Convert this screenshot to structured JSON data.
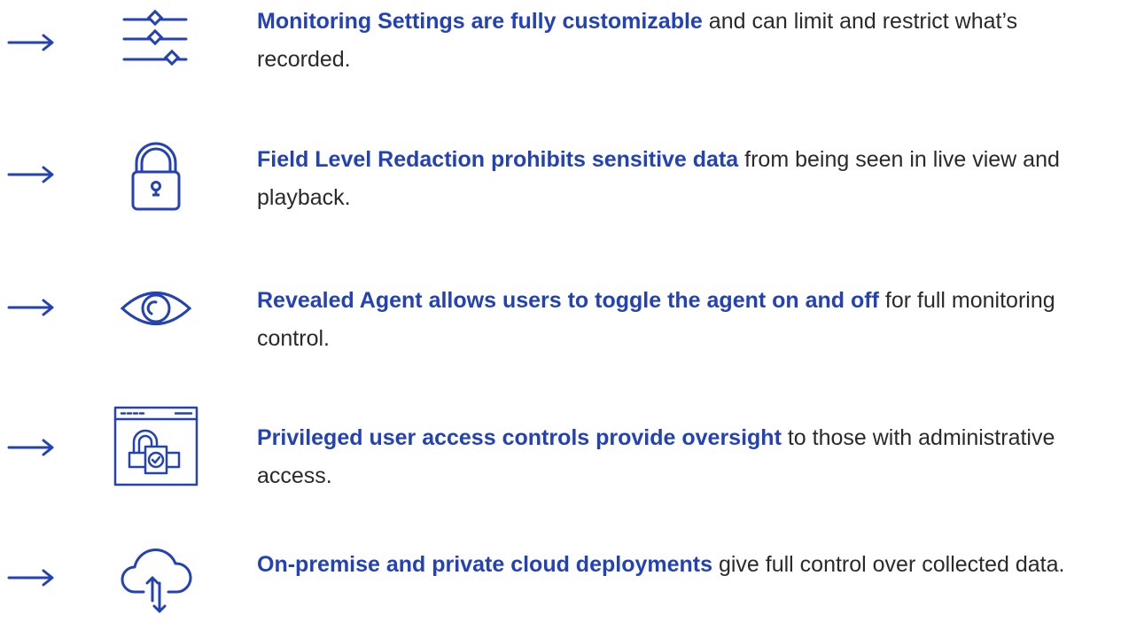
{
  "colors": {
    "accent": "#2342b5",
    "body_text": "#2a2a2a",
    "background": "#ffffff"
  },
  "features": [
    {
      "icon": "sliders-icon",
      "title": "Monitoring Settings are fully customizable",
      "rest": " and can limit and restrict what’s recorded."
    },
    {
      "icon": "padlock-icon",
      "title": "Field Level Redaction prohibits sensitive data",
      "rest": " from being seen in live view and playback."
    },
    {
      "icon": "eye-icon",
      "title": "Revealed Agent allows users to toggle the agent on and off",
      "rest": " for full monitoring control."
    },
    {
      "icon": "browser-lock-icon",
      "title": "Privileged user access controls provide oversight",
      "rest": " to those with administrative access."
    },
    {
      "icon": "cloud-sync-icon",
      "title": "On-premise and private cloud deployments",
      "rest": " give full control over collected data."
    }
  ]
}
